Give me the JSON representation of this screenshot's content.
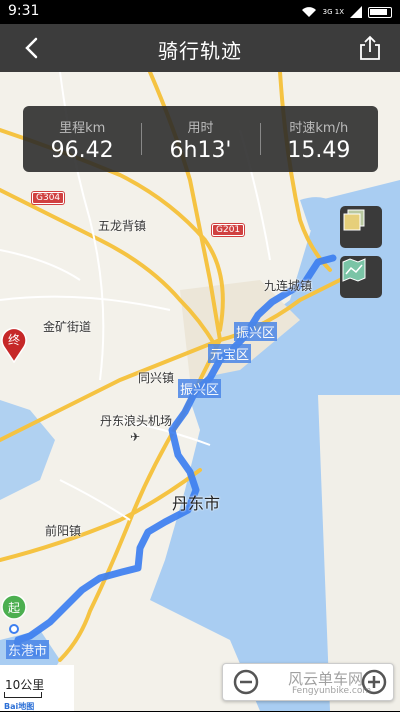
{
  "status_bar": {
    "time": "9:31",
    "network": "3G 1X"
  },
  "header": {
    "title": "骑行轨迹"
  },
  "stats": [
    {
      "label": "里程km",
      "value": "96.42"
    },
    {
      "label": "用时",
      "value": "6h13'"
    },
    {
      "label": "时速km/h",
      "value": "15.49"
    }
  ],
  "map": {
    "places": {
      "wulongbei": "五龙背镇",
      "jinkuang": "金矿街道",
      "jiulian": "九连城镇",
      "tongxing": "同兴镇",
      "airport": "丹东浪头机场",
      "dandong": "丹东市",
      "qianyang": "前阳镇",
      "donggang": "东港市",
      "zhenxing_1": "振兴区",
      "zhenxing_2": "振兴区",
      "yuanbao": "元宝区"
    },
    "roads": {
      "g304": "G304",
      "g201": "G201"
    },
    "markers": {
      "start": "起",
      "end": "终"
    },
    "scale": "10公里",
    "logo": "Bai地图"
  },
  "watermark": {
    "main": "风云单车网",
    "sub": "Fengyunbike.com"
  },
  "colors": {
    "track": "#3d7ff0",
    "start": "#4caf50",
    "end": "#c62828",
    "nav": "#3c3c3c"
  }
}
